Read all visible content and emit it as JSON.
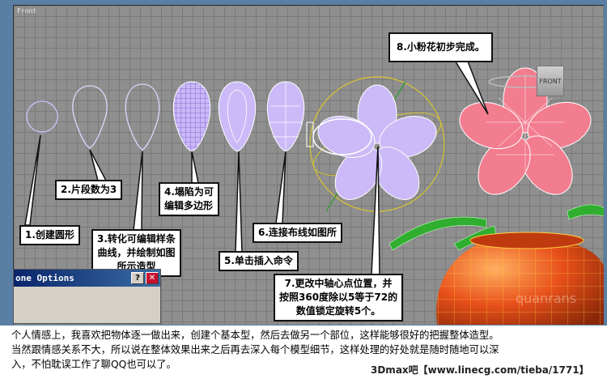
{
  "viewport": {
    "label": "Front",
    "view_cube_label": "FRONT",
    "overlay_text": "quanrans"
  },
  "callouts": [
    {
      "text": "1.创建圆形"
    },
    {
      "text": "2.片段数为3"
    },
    {
      "line1": "3.转化可编辑样条",
      "line2": "曲线，并绘制如图",
      "line3": "所示造型"
    },
    {
      "line1": "4.塌陷为可",
      "line2": "编辑多边形"
    },
    {
      "text": "5.单击插入命令"
    },
    {
      "text": "6.连接布线如图所"
    },
    {
      "line1": "7.更改中轴心点位置，并",
      "line2": "按照360度除以5等于72的",
      "line3": "数值锁定旋转5个。"
    },
    {
      "text": "8.小粉花初步完成。"
    }
  ],
  "dialog": {
    "title": "one Options",
    "help_label": "?",
    "close_label": "✕"
  },
  "caption": {
    "line1": "个人情感上，我喜欢把物体逐一做出来，创建个基本型，然后去做另一个部位，这样能够很好的把握整体造型。",
    "line2": "当然跟情感关系不大，所以说在整体效果出来之后再去深入每个模型细节，这样处理的好处就是随时随地可以深",
    "line3": "入，不怕耽误工作了聊QQ也可以了。"
  },
  "watermark": "3Dmax吧【www.linecg.com/tieba/1771】",
  "colors": {
    "viewport_bg": "#8f8f8f",
    "petal_lilac": "#c8b8f4",
    "flower_pink": "#f08090",
    "pot_orange": "#e8501a",
    "leaf_green": "#2faa2f",
    "callout_border": "#111111"
  }
}
